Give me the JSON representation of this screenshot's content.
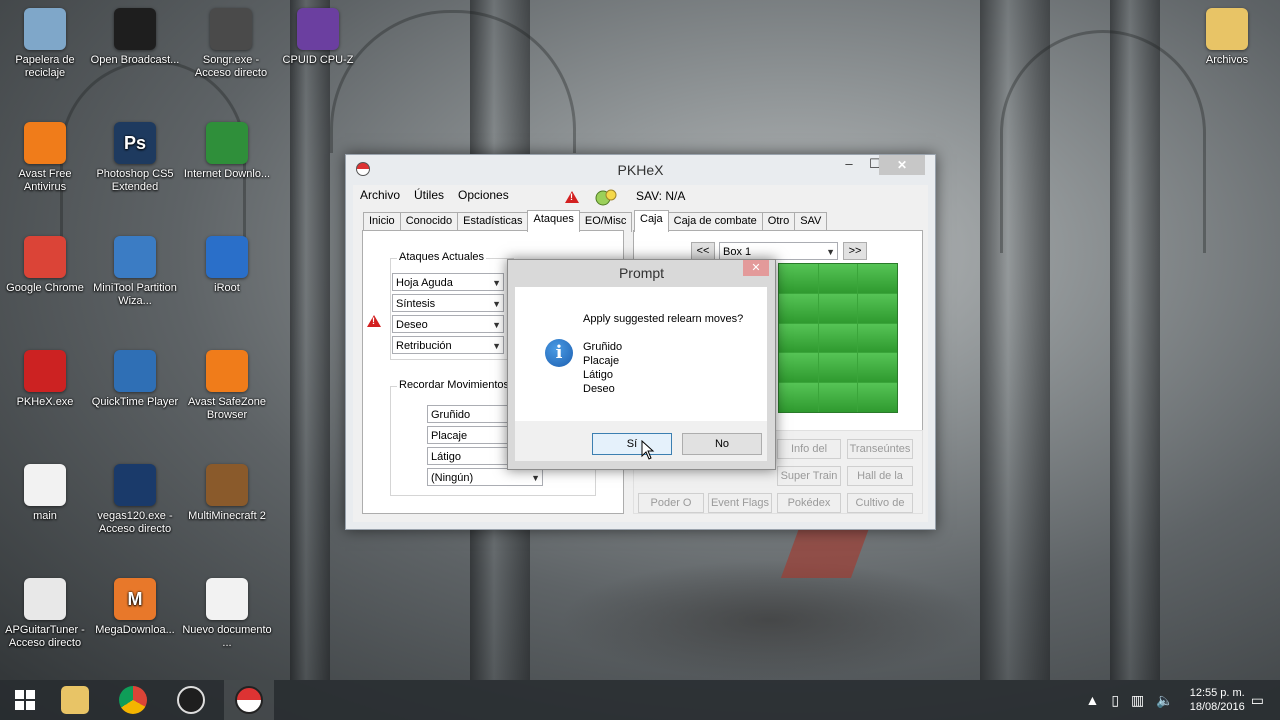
{
  "desktop": {
    "icons": [
      {
        "label": "Papelera de reciclaje",
        "icon": "recycle-bin-icon",
        "color": "#7fa7c9"
      },
      {
        "label": "Open Broadcast...",
        "icon": "obs-icon",
        "color": "#1e1e1e"
      },
      {
        "label": "Songr.exe - Acceso directo",
        "icon": "music-note-icon",
        "color": "#4a4a4a"
      },
      {
        "label": "CPUID CPU-Z",
        "icon": "cpu-icon",
        "color": "#6b3fa0"
      },
      {
        "label": "Avast Free Antivirus",
        "icon": "avast-icon",
        "color": "#f07c1a"
      },
      {
        "label": "Photoshop CS5 Extended",
        "icon": "photoshop-icon",
        "color": "#1e3a5f",
        "text": "Ps"
      },
      {
        "label": "Internet Downlo...",
        "icon": "download-manager-icon",
        "color": "#2f8f3a"
      },
      {
        "label": "Google Chrome",
        "icon": "chrome-icon",
        "color": "#db4437"
      },
      {
        "label": "MiniTool Partition Wiza...",
        "icon": "partition-wizard-icon",
        "color": "#3b7cc4"
      },
      {
        "label": "iRoot",
        "icon": "anchor-icon",
        "color": "#2a6fc9"
      },
      {
        "label": "PKHeX.exe",
        "icon": "pokeball-icon",
        "color": "#cc2222"
      },
      {
        "label": "QuickTime Player",
        "icon": "quicktime-icon",
        "color": "#2f6fb5"
      },
      {
        "label": "Avast SafeZone Browser",
        "icon": "safezone-icon",
        "color": "#f07c1a"
      },
      {
        "label": "main",
        "icon": "blank-file-icon",
        "color": "#f2f2f2"
      },
      {
        "label": "vegas120.exe - Acceso directo",
        "icon": "vegas-icon",
        "color": "#1a3a6a"
      },
      {
        "label": "MultiMinecraft 2",
        "icon": "chest-icon",
        "color": "#8a5a2b"
      },
      {
        "label": "APGuitarTuner - Acceso directo",
        "icon": "tuner-icon",
        "color": "#e8e8e8"
      },
      {
        "label": "MegaDownloa...",
        "icon": "mega-icon",
        "color": "#e8782a",
        "text": "M"
      },
      {
        "label": "Nuevo documento ...",
        "icon": "document-icon",
        "color": "#f2f2f2"
      },
      {
        "label": "Archivos",
        "icon": "folder-icon",
        "color": "#e8c466"
      }
    ]
  },
  "taskbar": {
    "time": "12:55 p. m.",
    "date": "18/08/2016"
  },
  "pkhex": {
    "title": "PKHeX",
    "menu": [
      "Archivo",
      "Útiles",
      "Opciones"
    ],
    "sav_label": "SAV: N/A",
    "left_tabs": [
      "Inicio",
      "Conocido",
      "Estadísticas",
      "Ataques",
      "EO/Misc"
    ],
    "right_tabs": [
      "Caja",
      "Caja de combate",
      "Otro",
      "SAV"
    ],
    "current_moves_caption": "Ataques Actuales",
    "current_moves": [
      "Hoja Aguda",
      "Síntesis",
      "Deseo",
      "Retribución"
    ],
    "relearn_caption": "Recordar Movimientos",
    "relearn_moves": [
      "Gruñido",
      "Placaje",
      "Látigo",
      "(Ningún)"
    ],
    "box_prev": "<<",
    "box_next": ">>",
    "box_name": "Box 1",
    "side_buttons": [
      "Info del",
      "Transeúntes",
      "Super Train",
      "Hall de la",
      "Poder O",
      "Event Flags",
      "Pokédex",
      "Cultivo de"
    ]
  },
  "prompt": {
    "title": "Prompt",
    "message": "Apply suggested relearn moves?",
    "moves": [
      "Gruñido",
      "Placaje",
      "Látigo",
      "Deseo"
    ],
    "yes": "Sí",
    "no": "No"
  }
}
